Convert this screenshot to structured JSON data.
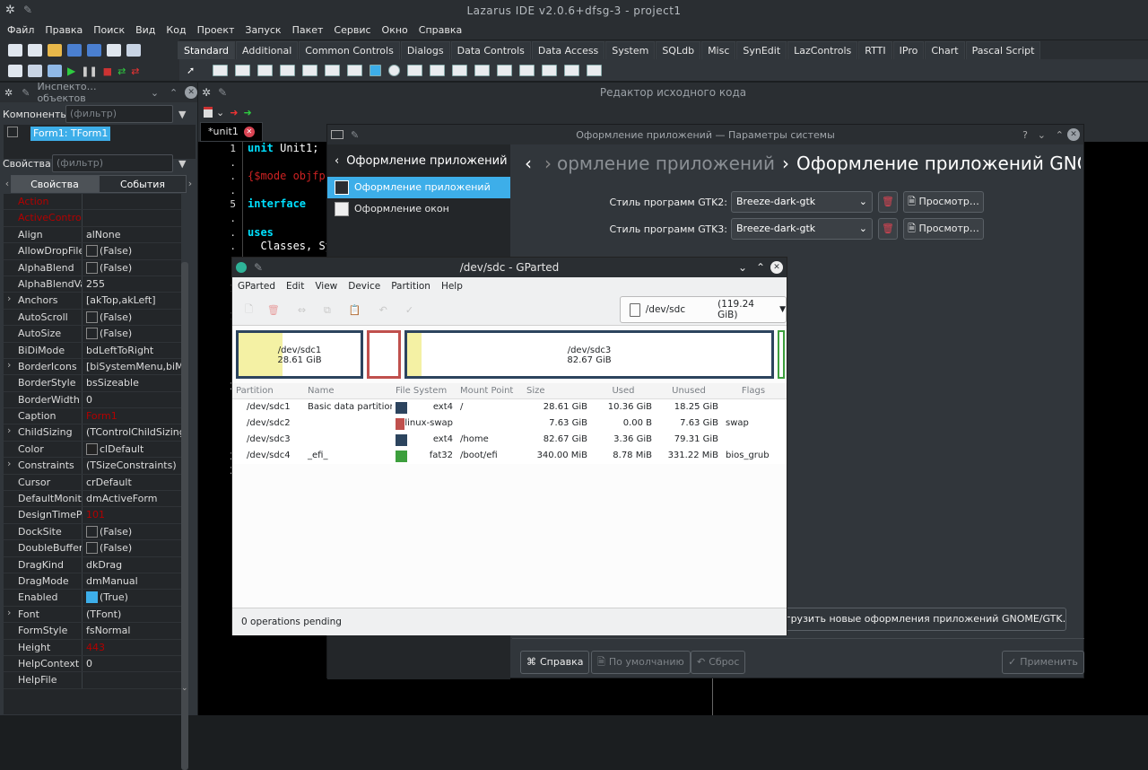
{
  "window_title": "Lazarus IDE v2.0.6+dfsg-3 - project1",
  "menu": [
    "Файл",
    "Правка",
    "Поиск",
    "Вид",
    "Код",
    "Проект",
    "Запуск",
    "Пакет",
    "Сервис",
    "Окно",
    "Справка"
  ],
  "palette_tabs": [
    "Standard",
    "Additional",
    "Common Controls",
    "Dialogs",
    "Data Controls",
    "Data Access",
    "System",
    "SQLdb",
    "Misc",
    "SynEdit",
    "LazControls",
    "RTTI",
    "IPro",
    "Chart",
    "Pascal Script"
  ],
  "inspector": {
    "title": "Инспекто…объектов",
    "components_label": "Компоненты",
    "filter_placeholder": "(фильтр)",
    "tree_item": "Form1: TForm1",
    "props_label": "Свойства",
    "tab_props": "Свойства",
    "tab_events": "События",
    "properties": [
      {
        "name": "Action",
        "value": "",
        "red": true
      },
      {
        "name": "ActiveControl",
        "value": "",
        "red": true
      },
      {
        "name": "Align",
        "value": "alNone"
      },
      {
        "name": "AllowDropFiles",
        "value": "(False)",
        "check": "off"
      },
      {
        "name": "AlphaBlend",
        "value": "(False)",
        "check": "off"
      },
      {
        "name": "AlphaBlendValue",
        "value": "255"
      },
      {
        "name": "Anchors",
        "value": "[akTop,akLeft]",
        "exp": true
      },
      {
        "name": "AutoScroll",
        "value": "(False)",
        "check": "off"
      },
      {
        "name": "AutoSize",
        "value": "(False)",
        "check": "off"
      },
      {
        "name": "BiDiMode",
        "value": "bdLeftToRight"
      },
      {
        "name": "BorderIcons",
        "value": "[biSystemMenu,biMinimize]",
        "exp": true
      },
      {
        "name": "BorderStyle",
        "value": "bsSizeable"
      },
      {
        "name": "BorderWidth",
        "value": "0"
      },
      {
        "name": "Caption",
        "value": "Form1",
        "valred": true
      },
      {
        "name": "ChildSizing",
        "value": "(TControlChildSizing)",
        "exp": true
      },
      {
        "name": "Color",
        "value": "clDefault",
        "check": "color"
      },
      {
        "name": "Constraints",
        "value": "(TSizeConstraints)",
        "exp": true
      },
      {
        "name": "Cursor",
        "value": "crDefault"
      },
      {
        "name": "DefaultMonitor",
        "value": "dmActiveForm"
      },
      {
        "name": "DesignTimePPI",
        "value": "101",
        "valred": true
      },
      {
        "name": "DockSite",
        "value": "(False)",
        "check": "off"
      },
      {
        "name": "DoubleBuffered",
        "value": "(False)",
        "check": "off"
      },
      {
        "name": "DragKind",
        "value": "dkDrag"
      },
      {
        "name": "DragMode",
        "value": "dmManual"
      },
      {
        "name": "Enabled",
        "value": "(True)",
        "check": "on"
      },
      {
        "name": "Font",
        "value": "(TFont)",
        "exp": true
      },
      {
        "name": "FormStyle",
        "value": "fsNormal"
      },
      {
        "name": "Height",
        "value": "443",
        "valred": true
      },
      {
        "name": "HelpContext",
        "value": "0"
      },
      {
        "name": "HelpFile",
        "value": ""
      }
    ]
  },
  "editor": {
    "title": "Редактор исходного кода",
    "tab": "*unit1",
    "gutter": [
      "1",
      ".",
      ".",
      ".",
      "5",
      ".",
      ".",
      ".",
      ".",
      "",
      "1",
      "",
      "1",
      "",
      "",
      "",
      "",
      "2",
      "",
      "",
      "",
      "",
      "2",
      "2"
    ],
    "code": [
      {
        "t": "kw",
        "a": "unit",
        "b": " Unit1;"
      },
      {
        "t": "blank"
      },
      {
        "t": "cm",
        "a": "{$mode objfpc",
        "b": ""
      },
      {
        "t": "blank"
      },
      {
        "t": "kw",
        "a": "interface",
        "b": ""
      },
      {
        "t": "blank"
      },
      {
        "t": "kw",
        "a": "uses",
        "b": ""
      },
      {
        "t": "plain",
        "a": "  Classes, Sy",
        "b": ""
      }
    ]
  },
  "settings": {
    "title": "Оформление приложений — Параметры системы",
    "sidebar_header": "Оформление приложений",
    "sidebar_items": [
      "Оформление приложений",
      "Оформление окон"
    ],
    "breadcrumb_prev": "ормление приложений",
    "breadcrumb_current": "Оформление приложений GNOME/GTK",
    "gtk2_label": "Стиль программ GTK2:",
    "gtk3_label": "Стиль программ GTK3:",
    "gtk2_value": "Breeze-dark-gtk",
    "gtk3_value": "Breeze-dark-gtk",
    "preview": "Просмотр…",
    "download": "Загрузить новые оформления приложений GNOME/GTK…",
    "help": "Справка",
    "defaults": "По умолчанию",
    "reset": "Сброс",
    "apply": "Применить"
  },
  "gparted": {
    "title": "/dev/sdc - GParted",
    "menu": [
      "GParted",
      "Edit",
      "View",
      "Device",
      "Partition",
      "Help"
    ],
    "device": "/dev/sdc",
    "device_size": "(119.24 GiB)",
    "map": [
      {
        "name": "/dev/sdc1",
        "size": "28.61 GiB"
      },
      {
        "name": "/dev/sdc3",
        "size": "82.67 GiB"
      }
    ],
    "columns": [
      "Partition",
      "Name",
      "File System",
      "Mount Point",
      "Size",
      "Used",
      "Unused",
      "Flags"
    ],
    "rows": [
      {
        "partition": "/dev/sdc1",
        "name": "Basic data partition",
        "color": "#2c445e",
        "fs": "ext4",
        "mount": "/",
        "size": "28.61 GiB",
        "used": "10.36 GiB",
        "unused": "18.25 GiB",
        "flags": ""
      },
      {
        "partition": "/dev/sdc2",
        "name": "",
        "color": "#c0504d",
        "fs": "linux-swap",
        "mount": "",
        "size": "7.63 GiB",
        "used": "0.00 B",
        "unused": "7.63 GiB",
        "flags": "swap"
      },
      {
        "partition": "/dev/sdc3",
        "name": "",
        "color": "#2c445e",
        "fs": "ext4",
        "mount": "/home",
        "size": "82.67 GiB",
        "used": "3.36 GiB",
        "unused": "79.31 GiB",
        "flags": ""
      },
      {
        "partition": "/dev/sdc4",
        "name": "_efi_",
        "color": "#3d9f3d",
        "fs": "fat32",
        "mount": "/boot/efi",
        "size": "340.00 MiB",
        "used": "8.78 MiB",
        "unused": "331.22 MiB",
        "flags": "bios_grub"
      }
    ],
    "status": "0 operations pending"
  }
}
